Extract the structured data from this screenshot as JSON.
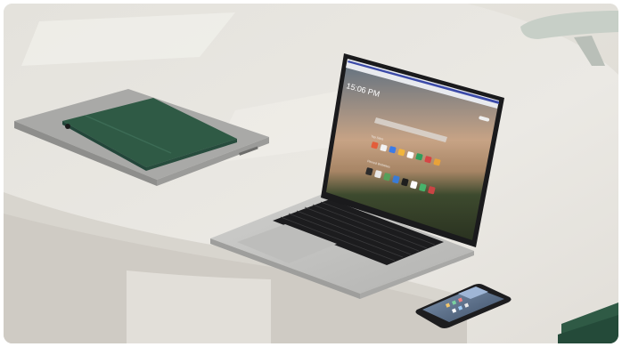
{
  "scene": {
    "laptop_screen": {
      "clock": "15:06 PM",
      "section_top_sites": "Top Sites",
      "section_favourites": "Pinned Websites",
      "top_site_colors": [
        "#e35d3a",
        "#f2f2f2",
        "#3b7be8",
        "#f2b63c",
        "#ffffff",
        "#2f9e5b",
        "#d64545",
        "#5a9bf0",
        "#f7f7f7",
        "#e8a23a"
      ],
      "pinned_colors": [
        "#2c2c2c",
        "#e8e8e8",
        "#56a05a",
        "#3a7bd5",
        "#1e1e1e",
        "#ffffff",
        "#47b36b",
        "#c94444"
      ]
    },
    "phone": {
      "widget_color": "#9fb6d6"
    },
    "colors": {
      "tablet_cover": "#2f5a45",
      "laptop_body": "#c9c9c7",
      "desk": "#e6e4de"
    }
  }
}
